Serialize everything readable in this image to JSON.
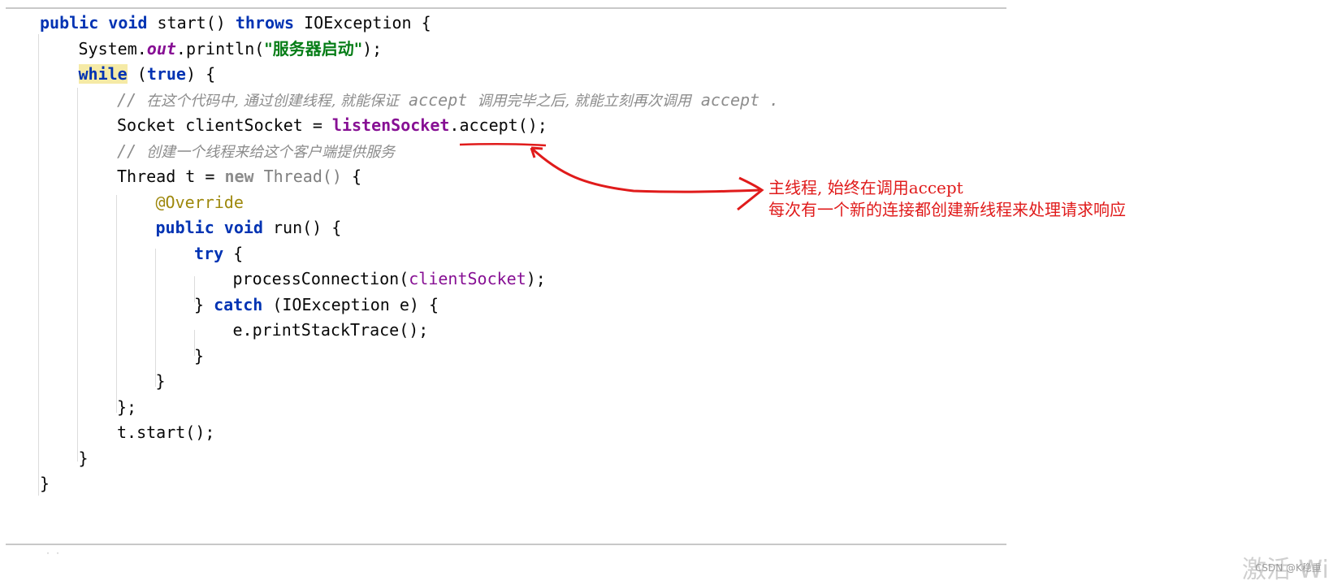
{
  "editor": {
    "lines": [
      {
        "tokens": [
          [
            "kw",
            "public"
          ],
          [
            "plain",
            " "
          ],
          [
            "kw",
            "void"
          ],
          [
            "plain",
            " start() "
          ],
          [
            "kw",
            "throws"
          ],
          [
            "plain",
            " IOException {"
          ]
        ]
      },
      {
        "tokens": [
          [
            "plain",
            "System."
          ],
          [
            "field-i",
            "out"
          ],
          [
            "plain",
            ".println("
          ],
          [
            "str",
            "\"服务器启动\""
          ],
          [
            "plain",
            ");"
          ]
        ]
      },
      {
        "tokens": [
          [
            "kw-hl",
            "while"
          ],
          [
            "plain",
            " ("
          ],
          [
            "kw",
            "true"
          ],
          [
            "plain",
            ") {"
          ]
        ]
      },
      {
        "tokens": [
          [
            "comment",
            "// "
          ],
          [
            "comment-cjk",
            "在这个代码中, 通过创建线程, 就能保证"
          ],
          [
            "comment",
            " accept "
          ],
          [
            "comment-cjk",
            "调用完毕之后, 就能立刻再次调用"
          ],
          [
            "comment",
            " accept ."
          ]
        ]
      },
      {
        "tokens": [
          [
            "plain",
            "Socket clientSocket = "
          ],
          [
            "field-b",
            "listenSocket"
          ],
          [
            "plain",
            ".accept();"
          ]
        ]
      },
      {
        "tokens": [
          [
            "comment",
            "// "
          ],
          [
            "comment-cjk",
            "创建一个线程来给这个客户端提供服务"
          ]
        ]
      },
      {
        "tokens": [
          [
            "plain",
            "Thread t = "
          ],
          [
            "kw-gray",
            "new"
          ],
          [
            "plain",
            " "
          ],
          [
            "gray",
            "Thread()"
          ],
          [
            "plain",
            " {"
          ]
        ]
      },
      {
        "tokens": [
          [
            "anno",
            "@Override"
          ]
        ]
      },
      {
        "tokens": [
          [
            "kw",
            "public"
          ],
          [
            "plain",
            " "
          ],
          [
            "kw",
            "void"
          ],
          [
            "plain",
            " run() {"
          ]
        ]
      },
      {
        "tokens": [
          [
            "kw",
            "try"
          ],
          [
            "plain",
            " {"
          ]
        ]
      },
      {
        "tokens": [
          [
            "plain",
            "processConnection("
          ],
          [
            "param",
            "clientSocket"
          ],
          [
            "plain",
            ");"
          ]
        ]
      },
      {
        "tokens": [
          [
            "plain",
            "} "
          ],
          [
            "kw",
            "catch"
          ],
          [
            "plain",
            " (IOException e) {"
          ]
        ]
      },
      {
        "tokens": [
          [
            "plain",
            "e.printStackTrace();"
          ]
        ]
      },
      {
        "tokens": [
          [
            "plain",
            "}"
          ]
        ]
      },
      {
        "tokens": [
          [
            "plain",
            "}"
          ]
        ]
      },
      {
        "tokens": [
          [
            "plain",
            "};"
          ]
        ]
      },
      {
        "tokens": [
          [
            "plain",
            "t.start();"
          ]
        ]
      },
      {
        "tokens": [
          [
            "plain",
            "}"
          ]
        ]
      },
      {
        "tokens": [
          [
            "plain",
            "}"
          ]
        ]
      }
    ]
  },
  "annotation": {
    "line1": "主线程, 始终在调用accept",
    "line2": "每次有一个新的连接都创建新线程来处理请求响应",
    "color": "#e01b1b"
  },
  "watermark": {
    "text": "激活 Wi",
    "csdn": "CSDN @K稳重"
  },
  "theme": {
    "keyword": "#0033b3",
    "string": "#067d17",
    "field": "#871094",
    "annotation": "#9e880d",
    "comment": "#8c8c8c"
  }
}
